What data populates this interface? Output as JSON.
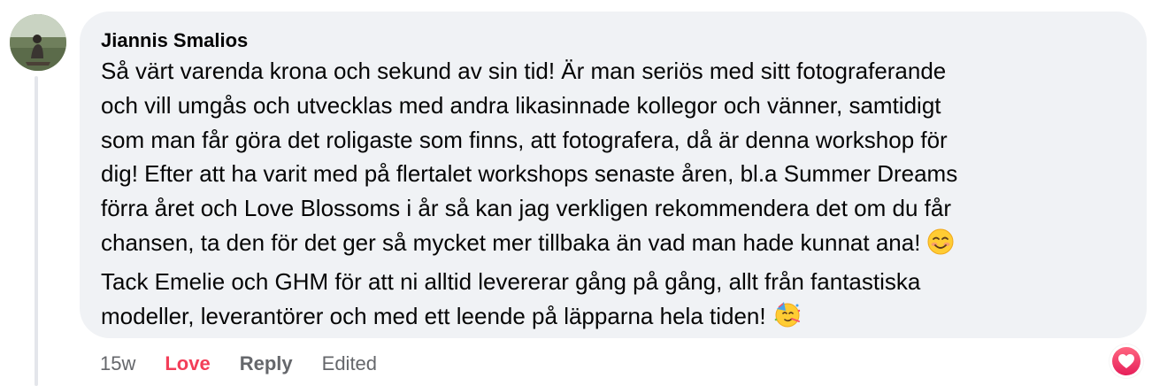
{
  "comment": {
    "author": "Jiannis Smalios",
    "lines": [
      "Så värt varenda krona och sekund av sin tid! Är man seriös med sitt fotograferande",
      "och vill umgås och utvecklas med andra likasinnade kollegor och vänner, samtidigt",
      "som man får göra det roligaste som finns, att fotografera, då är denna workshop för",
      "dig! Efter att ha varit med på flertalet workshops senaste åren, bl.a Summer Dreams",
      "förra året och Love Blossoms i år så kan jag verkligen rekommendera det om du får",
      "chansen, ta den för det ger så mycket mer tillbaka än vad man hade kunnat ana!",
      "Tack Emelie och GHM för att ni alltid levererar gång på gång, allt från fantastiska",
      "modeller, leverantörer och med ett leende på läpparna hela tiden!"
    ],
    "emoji_line6": "smiling-face-emoji",
    "emoji_line8": "partying-face-emoji"
  },
  "actions": {
    "timestamp": "15w",
    "love_label": "Love",
    "reply_label": "Reply",
    "edited_label": "Edited"
  },
  "reaction": {
    "icon": "heart-icon",
    "color": "#f33e58"
  },
  "colors": {
    "bubble": "#f0f2f5",
    "text": "#050505",
    "muted": "#65676b",
    "love": "#f33e58"
  }
}
